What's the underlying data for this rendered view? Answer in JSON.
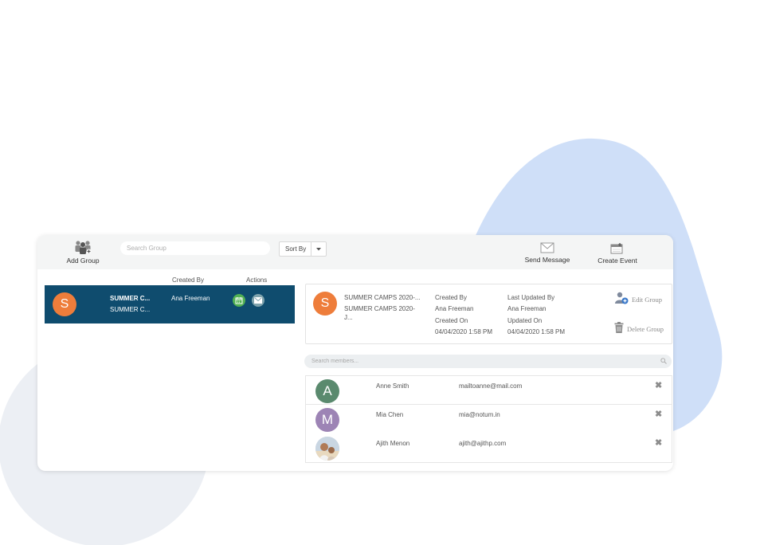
{
  "toolbar": {
    "add_group_label": "Add Group",
    "search_group_placeholder": "Search Group",
    "sort_by_label": "Sort By",
    "send_message_label": "Send Message",
    "create_event_label": "Create Event"
  },
  "group_list": {
    "columns": {
      "created_by": "Created By",
      "actions": "Actions"
    },
    "rows": [
      {
        "initial": "S",
        "name": "SUMMER C...",
        "subname": "SUMMER C...",
        "created_by": "Ana Freeman"
      }
    ]
  },
  "group_detail": {
    "initial": "S",
    "title": "SUMMER CAMPS 2020-...",
    "subtitle_line1": "SUMMER CAMPS 2020-",
    "subtitle_line2": "J...",
    "created_by_label": "Created By",
    "created_by": "Ana Freeman",
    "created_on_label": "Created On",
    "created_on": "04/04/2020 1:58 PM",
    "updated_by_label": "Last Updated By",
    "updated_by": "Ana Freeman",
    "updated_on_label": "Updated On",
    "updated_on": "04/04/2020 1:58 PM",
    "edit_label": "Edit Group",
    "delete_label": "Delete Group"
  },
  "members": {
    "search_placeholder": "Search members...",
    "items": [
      {
        "initial": "A",
        "name": "Anne Smith",
        "email": "mailtoanne@mail.com",
        "color": "#5a8a6e"
      },
      {
        "initial": "M",
        "name": "Mia Chen",
        "email": "mia@notum.in",
        "color": "#9d84b5"
      },
      {
        "initial": "",
        "name": "Ajith Menon",
        "email": "ajith@ajithp.com",
        "color": "#cfd8e3"
      }
    ]
  },
  "colors": {
    "selected_row": "#0f4c6e",
    "avatar_orange": "#ee7d3b",
    "blob_blue": "#cfdff8",
    "blob_gray": "#eceff4"
  }
}
